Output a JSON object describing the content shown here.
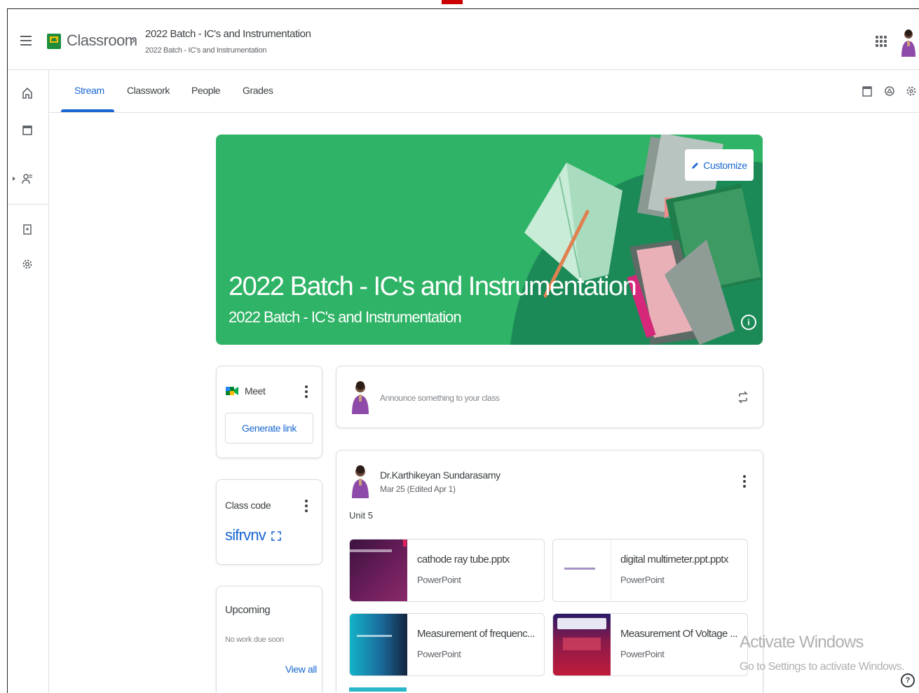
{
  "app": {
    "name": "Classroom",
    "class_title": "2022 Batch - IC's and Instrumentation",
    "class_subtitle": "2022 Batch - IC's and Instrumentation"
  },
  "tabs": [
    {
      "label": "Stream",
      "active": true
    },
    {
      "label": "Classwork",
      "active": false
    },
    {
      "label": "People",
      "active": false
    },
    {
      "label": "Grades",
      "active": false
    }
  ],
  "banner": {
    "title": "2022 Batch - IC's and Instrumentation",
    "subtitle": "2022 Batch - IC's and Instrumentation",
    "customize_label": "Customize",
    "color": "#2fb366"
  },
  "meet": {
    "label": "Meet",
    "generate_link_label": "Generate link"
  },
  "class_code": {
    "label": "Class code",
    "code": "sifrvnv"
  },
  "upcoming": {
    "label": "Upcoming",
    "empty_text": "No work due soon",
    "view_all_label": "View all"
  },
  "announce": {
    "placeholder": "Announce something to your class"
  },
  "post": {
    "author": "Dr.Karthikeyan Sundarasamy",
    "date": "Mar 25 (Edited Apr 1)",
    "text": "Unit 5",
    "attachments": [
      {
        "name": "cathode ray tube.pptx",
        "type": "PowerPoint"
      },
      {
        "name": "digital multimeter.ppt.pptx",
        "type": "PowerPoint"
      },
      {
        "name": "Measurement of frequenc...",
        "type": "PowerPoint"
      },
      {
        "name": "Measurement Of Voltage ...",
        "type": "PowerPoint"
      }
    ]
  },
  "watermark": {
    "line1": "Activate Windows",
    "line2": "Go to Settings to activate Windows."
  },
  "colors": {
    "accent": "#1967d2",
    "brand_green": "#1e8e3e"
  }
}
